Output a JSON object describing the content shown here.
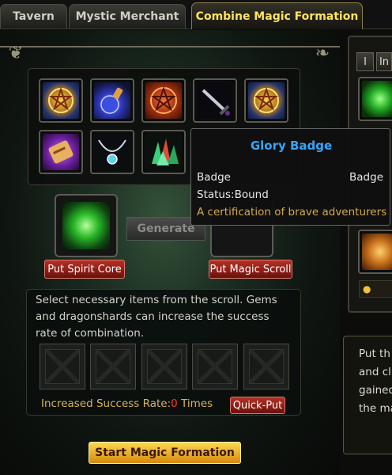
{
  "tabs": [
    {
      "label": "Tavern",
      "active": false
    },
    {
      "label": "Mystic Merchant",
      "active": false
    },
    {
      "label": "Combine Magic Formation",
      "active": true
    }
  ],
  "inventory": [
    {
      "icon": "golden-pentagram-amulet-icon",
      "color": "#d9a640"
    },
    {
      "icon": "blue-potion-icon",
      "color": "#5060e0"
    },
    {
      "icon": "red-pentagram-seal-icon",
      "color": "#c0451c"
    },
    {
      "icon": "steel-sword-icon",
      "color": "#9aa1b0"
    },
    {
      "icon": "golden-pentagram-amulet-icon",
      "color": "#d9a640"
    },
    {
      "icon": "purple-scroll-icon",
      "color": "#9f3fd0"
    },
    {
      "icon": "jeweled-necklace-icon",
      "color": "#77c0e0"
    },
    {
      "icon": "crystal-cluster-icon",
      "color": "#35c070"
    }
  ],
  "spirit_core": {
    "icon": "green-spirit-core-icon",
    "button": "Put Spirit Core"
  },
  "generate_label": "Generate",
  "magic_scroll": {
    "button": "Put Magic Scroll"
  },
  "instructions": "Select necessary items from the scroll. Gems and dragonshards can increase the success rate of combination.",
  "success_rate": {
    "prefix": "Increased Success Rate:",
    "value": "0",
    "suffix": " Times"
  },
  "quick_put_label": "Quick-Put",
  "start_label": "Start Magic Formation",
  "tooltip": {
    "title": "Glory Badge",
    "type_left": "Badge",
    "type_right": "Badge",
    "status": "Status:Bound",
    "description": "A certification of brave adventurers"
  },
  "right_panel": {
    "tabs": [
      "I",
      "In"
    ],
    "text_lines": [
      "Put th",
      "and cli",
      "gained",
      "the ma"
    ]
  },
  "colors": {
    "accent_gold": "#ffe45a",
    "tooltip_title": "#33a6ff",
    "button_red": "#b43025",
    "start_orange": "#f0b030"
  }
}
